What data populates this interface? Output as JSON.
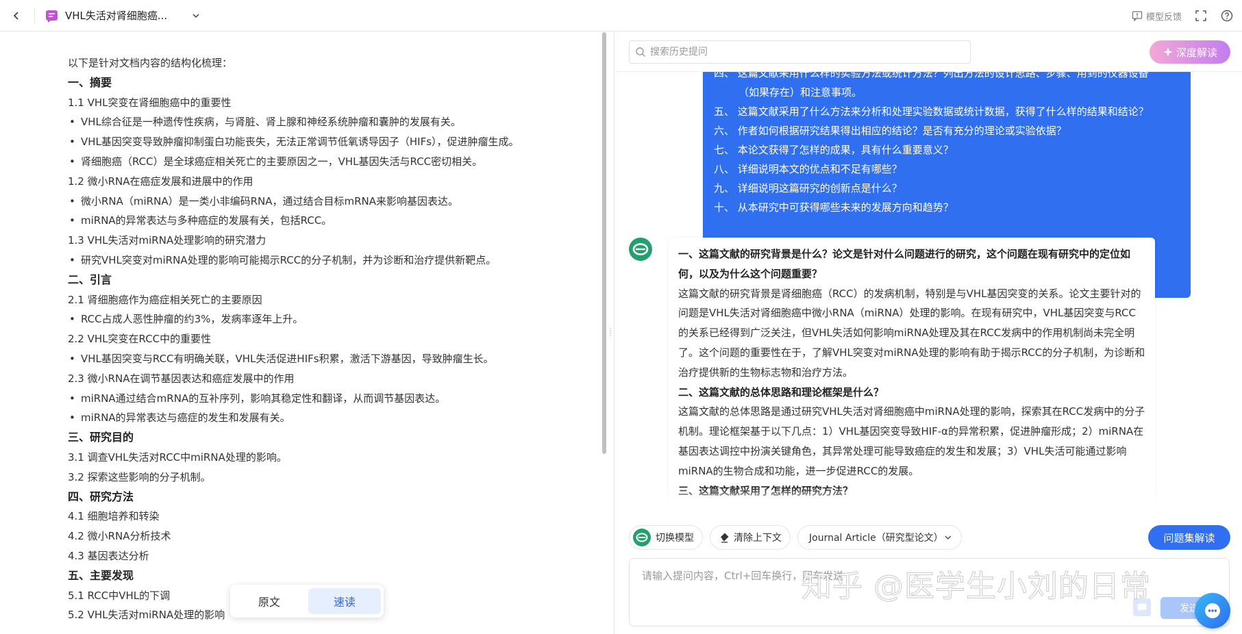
{
  "header": {
    "back_icon": "arrow-left-icon",
    "doc_icon": "doc-chat-icon",
    "title": "VHL失活对肾细胞癌...",
    "feedback_label": "模型反馈",
    "icons": [
      "feedback-icon",
      "fullscreen-icon",
      "help-icon"
    ]
  },
  "document": {
    "lines": [
      {
        "t": "p",
        "text": "以下是针对文档内容的结构化梳理："
      },
      {
        "t": "h",
        "text": "一、摘要"
      },
      {
        "t": "p",
        "text": "1.1 VHL突变在肾细胞癌中的重要性"
      },
      {
        "t": "b",
        "text": "VHL综合征是一种遗传性疾病，与肾脏、肾上腺和神经系统肿瘤和囊肿的发展有关。"
      },
      {
        "t": "b",
        "text": "VHL基因突变导致肿瘤抑制蛋白功能丧失，无法正常调节低氧诱导因子（HIFs），促进肿瘤生成。"
      },
      {
        "t": "b",
        "text": "肾细胞癌（RCC）是全球癌症相关死亡的主要原因之一，VHL基因失活与RCC密切相关。"
      },
      {
        "t": "p",
        "text": "1.2 微小RNA在癌症发展和进展中的作用"
      },
      {
        "t": "b",
        "text": "微小RNA（miRNA）是一类小非编码RNA，通过结合目标mRNA来影响基因表达。"
      },
      {
        "t": "b",
        "text": "miRNA的异常表达与多种癌症的发展有关，包括RCC。"
      },
      {
        "t": "p",
        "text": "1.3 VHL失活对miRNA处理影响的研究潜力"
      },
      {
        "t": "b",
        "text": "研究VHL突变对miRNA处理的影响可能揭示RCC的分子机制，并为诊断和治疗提供新靶点。"
      },
      {
        "t": "h",
        "text": "二、引言"
      },
      {
        "t": "p",
        "text": "2.1 肾细胞癌作为癌症相关死亡的主要原因"
      },
      {
        "t": "b",
        "text": "RCC占成人恶性肿瘤的约3%，发病率逐年上升。"
      },
      {
        "t": "p",
        "text": "2.2 VHL突变在RCC中的重要性"
      },
      {
        "t": "b",
        "text": "VHL基因突变与RCC有明确关联，VHL失活促进HIFs积累，激活下游基因，导致肿瘤生长。"
      },
      {
        "t": "p",
        "text": "2.3 微小RNA在调节基因表达和癌症发展中的作用"
      },
      {
        "t": "b",
        "text": "miRNA通过结合mRNA的互补序列，影响其稳定性和翻译，从而调节基因表达。"
      },
      {
        "t": "b",
        "text": "miRNA的异常表达与癌症的发生和发展有关。"
      },
      {
        "t": "h",
        "text": "三、研究目的"
      },
      {
        "t": "p",
        "text": "3.1 调查VHL失活对RCC中miRNA处理的影响。"
      },
      {
        "t": "p",
        "text": "3.2 探索这些影响的分子机制。"
      },
      {
        "t": "h",
        "text": "四、研究方法"
      },
      {
        "t": "p",
        "text": "4.1 细胞培养和转染"
      },
      {
        "t": "p",
        "text": "4.2 微小RNA分析技术"
      },
      {
        "t": "p",
        "text": "4.3 基因表达分析"
      },
      {
        "t": "h",
        "text": "五、主要发现"
      },
      {
        "t": "p",
        "text": "5.1 RCC中VHL的下调"
      },
      {
        "t": "p",
        "text": "5.2 VHL失活对miRNA处理的影响"
      }
    ],
    "mode_original": "原文",
    "mode_speed": "速读",
    "active_mode": "速读"
  },
  "chat": {
    "search_placeholder": "搜索历史提问",
    "deep_label": "深度解读",
    "user_questions": [
      "四、 这篇文献采用什么样的实验方法或统计方法？列出方法的设计思路、步骤、用到的仪器设备",
      "（如果存在）和注意事项。",
      "五、 这篇文献采用了什么方法来分析和处理实验数据或统计数据，获得了什么样的结果和结论？",
      "六、 作者如何根据研究结果得出相应的结论？是否有充分的理论或实验依据？",
      "七、 本论文获得了怎样的成果，具有什么重要意义？",
      "八、 详细说明本文的优点和不足有哪些？",
      "九、 详细说明这篇研究的创新点是什么？",
      "十、 从本研究中可获得哪些未来的发展方向和趋势？"
    ],
    "ai_answer": [
      {
        "t": "h",
        "text": "一、这篇文献的研究背景是什么？论文是针对什么问题进行的研究，这个问题在现有研究中的定位如何，以及为什么这个问题重要？"
      },
      {
        "t": "p",
        "text": "这篇文献的研究背景是肾细胞癌（RCC）的发病机制，特别是与VHL基因突变的关系。论文主要针对的问题是VHL失活对肾细胞癌中微小RNA（miRNA）处理的影响。在现有研究中，VHL基因突变与RCC的关系已经得到广泛关注，但VHL失活如何影响miRNA处理及其在RCC发病中的作用机制尚未完全明了。这个问题的重要性在于，了解VHL突变对miRNA处理的影响有助于揭示RCC的分子机制，为诊断和治疗提供新的生物标志物和治疗方法。"
      },
      {
        "t": "h",
        "text": "二、这篇文献的总体思路和理论框架是什么？"
      },
      {
        "t": "p",
        "text": "这篇文献的总体思路是通过研究VHL失活对肾细胞癌中miRNA处理的影响，探索其在RCC发病中的分子机制。理论框架基于以下几点：1）VHL基因突变导致HIF-α的异常积累，促进肿瘤形成；2）miRNA在基因表达调控中扮演关键角色，其异常处理可能导致癌症的发生和发展；3）VHL失活可能通过影响miRNA的生物合成和功能，进一步促进RCC的发展。"
      },
      {
        "t": "h",
        "text": "三、这篇文献采用了怎样的研究方法？"
      }
    ],
    "switch_model_label": "切换模型",
    "clear_context_label": "清除上下文",
    "article_type_label": "Journal Article（研究型论文）",
    "qset_label": "问题集解读",
    "input_placeholder": "请输入提问内容，Ctrl+回车换行，回车发送",
    "send_label": "发送",
    "watermark": "知乎 @医学生小刘的日常"
  },
  "colors": {
    "accent": "#2f6ff0",
    "user_bubble": "#2f6ff0",
    "deep_gradient_start": "#f3a8d6",
    "deep_gradient_end": "#c27df0"
  }
}
